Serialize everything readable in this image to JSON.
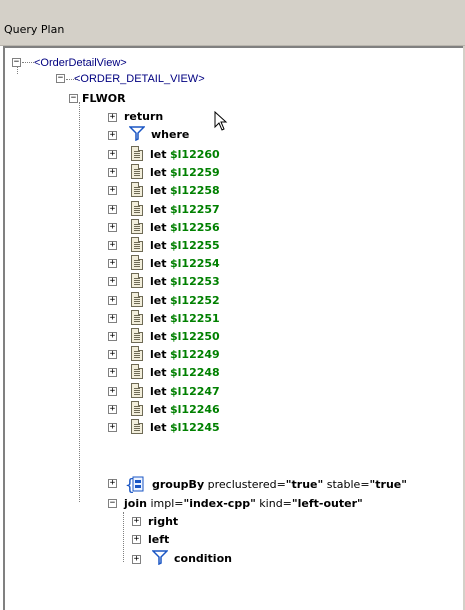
{
  "panel": {
    "title": "Query Plan"
  },
  "tree": {
    "root": "<OrderDetailView>",
    "child": "<ORDER_DETAIL_VIEW>",
    "flwor": "FLWOR",
    "return": "return",
    "where": "where",
    "let_keyword": "let",
    "lets": [
      "$l12260",
      "$l12259",
      "$l12258",
      "$l12257",
      "$l12256",
      "$l12255",
      "$l12254",
      "$l12253",
      "$l12252",
      "$l12251",
      "$l12250",
      "$l12249",
      "$l12248",
      "$l12247",
      "$l12246",
      "$l12245"
    ],
    "groupby": {
      "keyword": "groupBy",
      "attr1_name": "preclustered=",
      "attr1_val": "\"true\"",
      "attr2_name": "stable=",
      "attr2_val": "\"true\""
    },
    "join": {
      "keyword": "join",
      "attr1_name": "impl=",
      "attr1_val": "\"index-cpp\"",
      "attr2_name": "kind=",
      "attr2_val": "\"left-outer\""
    },
    "right": "right",
    "left": "left",
    "condition": "condition"
  }
}
